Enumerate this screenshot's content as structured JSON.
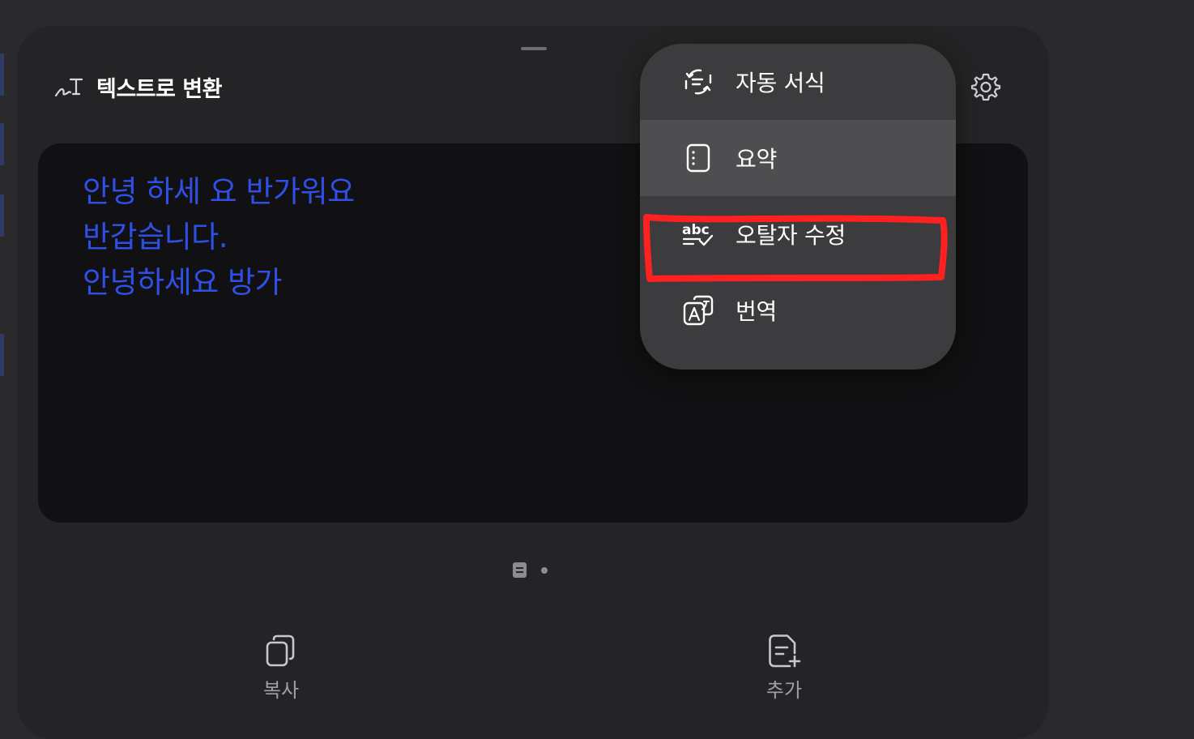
{
  "colors": {
    "background": "#2a2a2c",
    "sheet": "#242426",
    "text_box": "#111113",
    "recognized_text": "#2f4fe6",
    "menu": "#3c3c3f",
    "menu_highlight": "#4e4e51",
    "annotation": "#ff2020"
  },
  "header": {
    "icon": "handwriting-to-text-icon",
    "title": "텍스트로 변환",
    "settings_icon": "gear-icon"
  },
  "recognized_lines": [
    "안녕 하세 요 반가워요",
    "반갑습니다.",
    "안녕하세요 방가"
  ],
  "menu": {
    "items": [
      {
        "label": "자동 서식",
        "icon": "auto-format-icon",
        "highlighted": false
      },
      {
        "label": "요약",
        "icon": "summary-icon",
        "highlighted": true
      },
      {
        "label": "오탈자 수정",
        "icon": "spell-check-icon",
        "highlighted": false,
        "annotated": true
      },
      {
        "label": "번역",
        "icon": "translate-icon",
        "highlighted": false
      }
    ]
  },
  "pager": {
    "icons": [
      "document-page-icon",
      "page-dot-icon"
    ],
    "current_page": 1,
    "total_pages": 2
  },
  "actions": {
    "copy": {
      "label": "복사",
      "icon": "copy-icon"
    },
    "add": {
      "label": "추가",
      "icon": "add-note-icon"
    }
  }
}
